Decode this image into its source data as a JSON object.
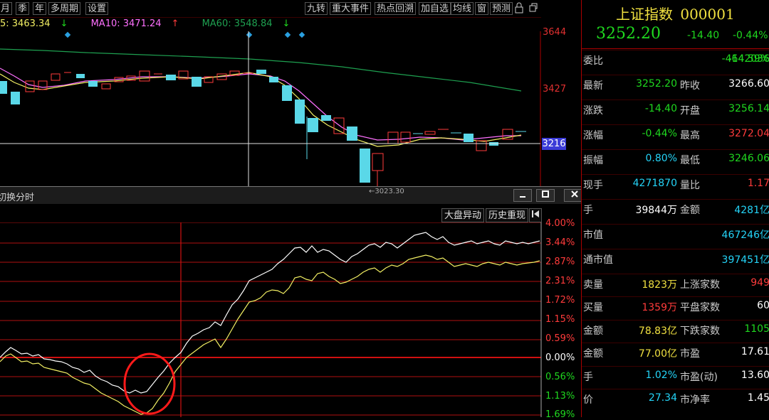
{
  "toolbar": {
    "left_items": [
      "月",
      "季",
      "年",
      "多周期",
      "设置"
    ],
    "right_items": [
      "九转",
      "重大事件",
      "热点回溯",
      "加自选",
      "均线",
      "窗",
      "预测"
    ],
    "icons": [
      "lock-icon",
      "restore-icon"
    ]
  },
  "ma_legend": {
    "ma5": "5: 3463.34",
    "ma5_arrow": "↓",
    "ma10": "MA10: 3471.24",
    "ma10_arrow": "↑",
    "ma60": "MA60: 3548.84",
    "ma60_arrow": "↓",
    "colors": {
      "ma5": "#f2ef63",
      "ma10": "#ff70ff",
      "ma60": "#1ea050"
    }
  },
  "kline": {
    "price_labels": [
      "3644",
      "3427"
    ],
    "crosshair_price": "3216",
    "low_label": "←3023.30"
  },
  "popup": {
    "title": "切换分时",
    "buttons": [
      "大盘异动",
      "历史重现"
    ],
    "pct_labels": [
      {
        "text": "4.00%",
        "color": "#ff3b3b"
      },
      {
        "text": "3.44%",
        "color": "#ff3b3b"
      },
      {
        "text": "2.87%",
        "color": "#ff3b3b"
      },
      {
        "text": "2.31%",
        "color": "#ff3b3b"
      },
      {
        "text": "1.72%",
        "color": "#ff3b3b"
      },
      {
        "text": "1.15%",
        "color": "#ff3b3b"
      },
      {
        "text": "0.59%",
        "color": "#ff3b3b"
      },
      {
        "text": "0.00%",
        "color": "#ffffff"
      },
      {
        "text": "0.56%",
        "color": "#1fd81f"
      },
      {
        "text": "1.13%",
        "color": "#1fd81f"
      },
      {
        "text": "1.69%",
        "color": "#1fd81f"
      }
    ]
  },
  "panel": {
    "name": "上证指数",
    "code": "000001",
    "price": "3252.20",
    "change": "-14.40",
    "change_pct": "-0.44%",
    "rows": [
      {
        "l1": "委比",
        "v1": "-14.59%",
        "c1": "green",
        "l2": "",
        "v2": "-4642036",
        "c2": "green"
      },
      {
        "l1": "最新",
        "v1": "3252.20",
        "c1": "green",
        "l2": "昨收",
        "v2": "3266.60",
        "c2": "white"
      },
      {
        "l1": "涨跌",
        "v1": "-14.40",
        "c1": "green",
        "l2": "开盘",
        "v2": "3256.14",
        "c2": "green"
      },
      {
        "l1": "涨幅",
        "v1": "-0.44%",
        "c1": "green",
        "l2": "最高",
        "v2": "3272.04",
        "c2": "red"
      },
      {
        "l1": "振幅",
        "v1": "0.80%",
        "c1": "cyan",
        "l2": "最低",
        "v2": "3246.06",
        "c2": "green"
      },
      {
        "l1": "现手",
        "v1": "4271870",
        "c1": "cyan",
        "l2": "量比",
        "v2": "1.17",
        "c2": "red"
      },
      {
        "l1": "手",
        "v1": "39844万",
        "c1": "white",
        "l2": "金额",
        "v2": "4281亿",
        "c2": "cyan"
      },
      {
        "l1": "市值",
        "v1": "467246亿",
        "c1": "cyan",
        "l2": "",
        "v2": "",
        "c2": "white"
      },
      {
        "l1": "通市值",
        "v1": "397451亿",
        "c1": "cyan",
        "l2": "",
        "v2": "",
        "c2": "white"
      },
      {
        "l1": "卖量",
        "v1": "1823万",
        "c1": "yellow",
        "l2": "上涨家数",
        "v2": "949",
        "c2": "red"
      },
      {
        "l1": "买量",
        "v1": "1359万",
        "c1": "red",
        "l2": "平盘家数",
        "v2": "60",
        "c2": "white"
      },
      {
        "l1": "金额",
        "v1": "78.83亿",
        "c1": "yellow",
        "l2": "下跌家数",
        "v2": "1105",
        "c2": "green"
      },
      {
        "l1": "金额",
        "v1": "77.00亿",
        "c1": "yellow",
        "l2": "市盈",
        "v2": "17.61",
        "c2": "white"
      },
      {
        "l1": "手",
        "v1": "1.02%",
        "c1": "cyan",
        "l2": "市盈(动)",
        "v2": "13.60",
        "c2": "white"
      },
      {
        "l1": "价",
        "v1": "27.34",
        "c1": "cyan",
        "l2": "市净率",
        "v2": "1.45",
        "c2": "white"
      }
    ]
  }
}
